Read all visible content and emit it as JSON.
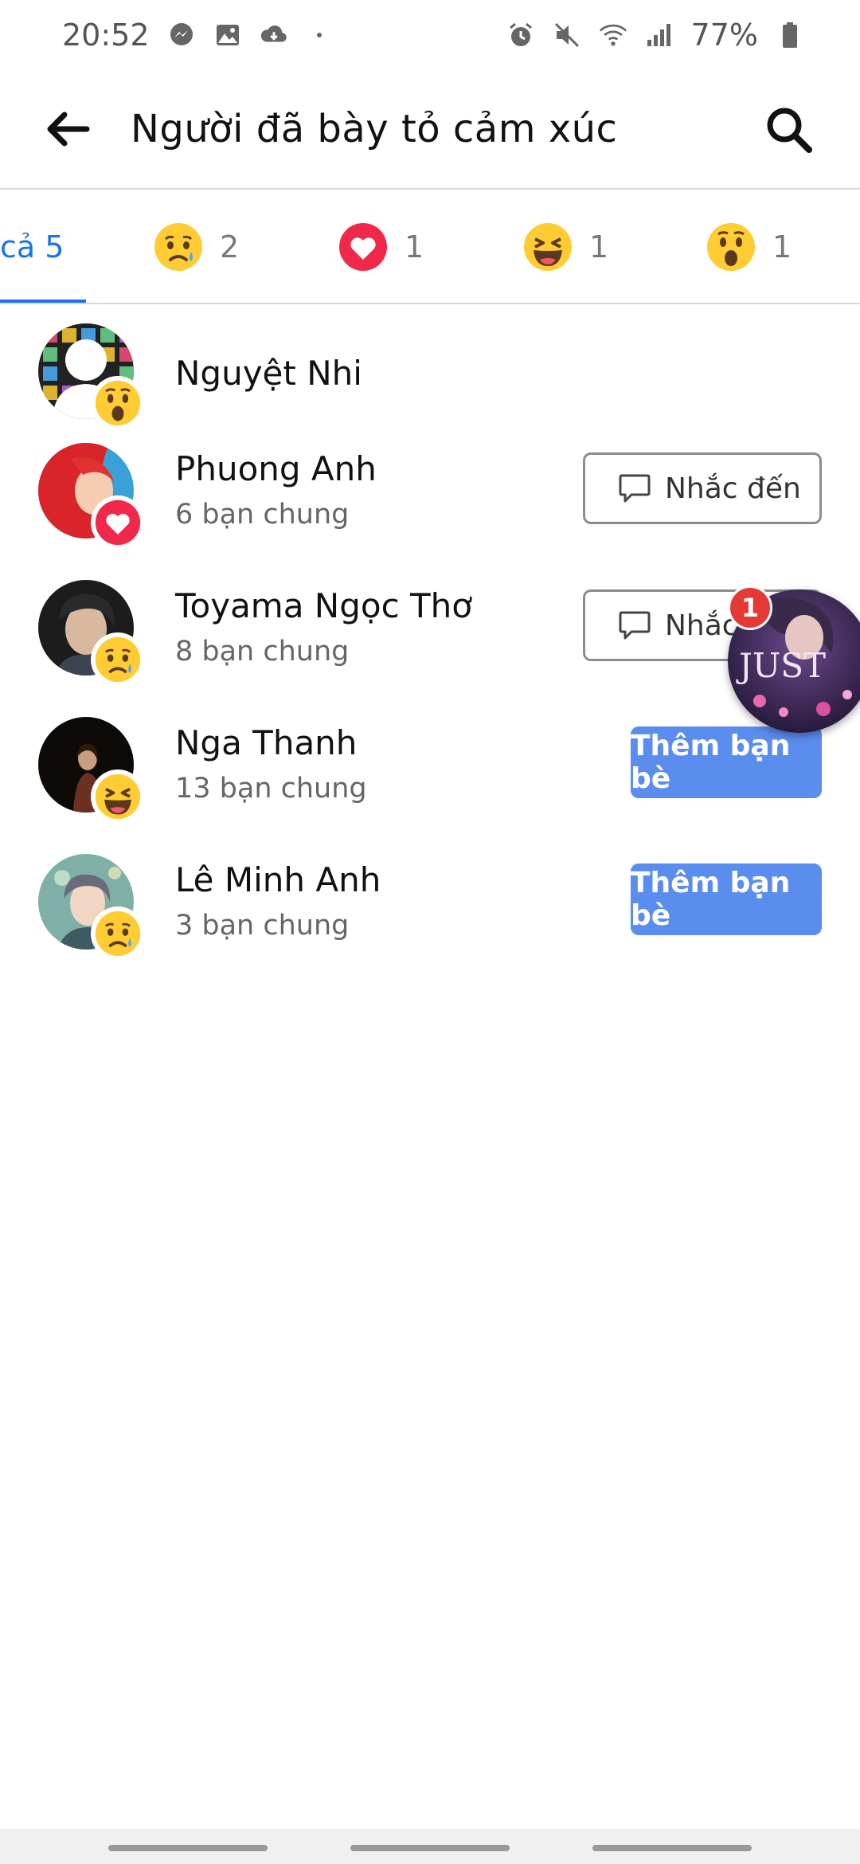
{
  "status_bar": {
    "time": "20:52",
    "battery": "77%",
    "left_icons": [
      "messenger-icon",
      "image-icon",
      "cloud-icon"
    ],
    "right_icons": [
      "alarm-icon",
      "mute-icon",
      "wifi-icon",
      "signal-icon",
      "battery-icon"
    ]
  },
  "header": {
    "title": "Người đã bày tỏ cảm xúc"
  },
  "tabs": [
    {
      "label": "cả 5",
      "emoji": null
    },
    {
      "label": "2",
      "emoji": "sad"
    },
    {
      "label": "1",
      "emoji": "love"
    },
    {
      "label": "1",
      "emoji": "haha"
    },
    {
      "label": "1",
      "emoji": "wow"
    }
  ],
  "people": [
    {
      "name": "Nguyệt Nhi",
      "mutual": "",
      "reaction": "wow",
      "action": null
    },
    {
      "name": "Phuong Anh",
      "mutual": "6 bạn chung",
      "reaction": "love",
      "action": "Nhắc đến"
    },
    {
      "name": "Toyama Ngọc Thơ",
      "mutual": "8 bạn chung",
      "reaction": "sad",
      "action": "Nhắc"
    },
    {
      "name": "Nga Thanh",
      "mutual": "13 bạn chung",
      "reaction": "haha",
      "action": "Thêm bạn bè"
    },
    {
      "name": "Lê Minh Anh",
      "mutual": "3 bạn chung",
      "reaction": "sad",
      "action": "Thêm bạn bè"
    }
  ],
  "chathead": {
    "badge": "1",
    "image_text": "JUST"
  },
  "colors": {
    "accent": "#1a73e8",
    "add_button": "#5b8def",
    "love": "#f0284a",
    "emoji_yellow": "#ffcc33"
  }
}
